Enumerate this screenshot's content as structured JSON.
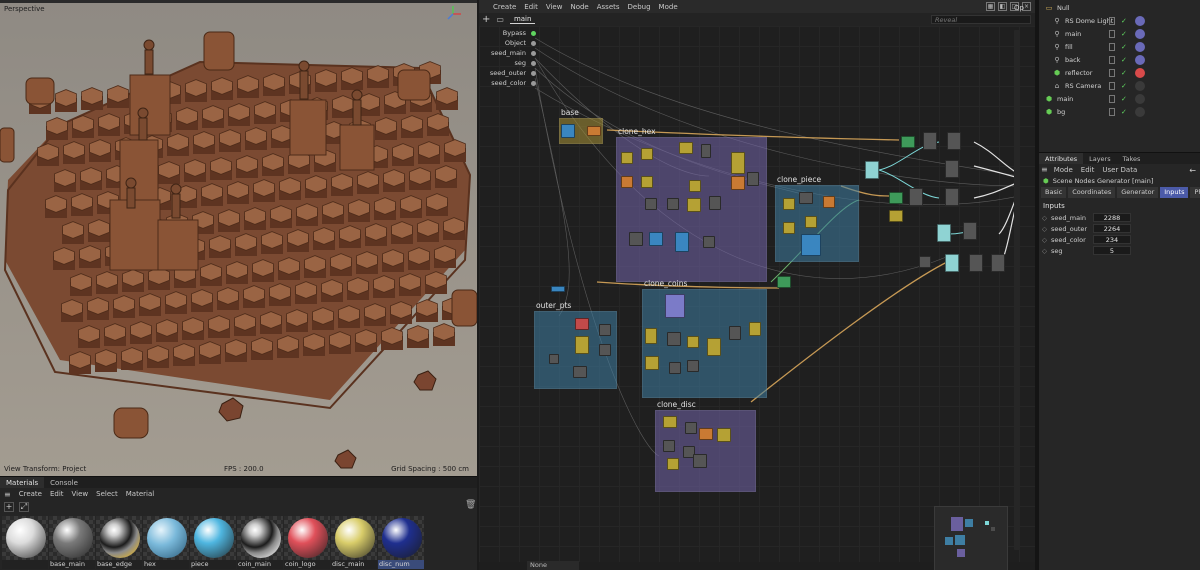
{
  "viewport": {
    "view_name": "Perspective",
    "view_transform": "View Transform: Project",
    "fps": "FPS : 200.0",
    "grid_spacing": "Grid Spacing : 500 cm"
  },
  "materials": {
    "tabs": [
      "Materials",
      "Console"
    ],
    "active_tab": "Materials",
    "menu": [
      "Create",
      "Edit",
      "View",
      "Select",
      "Material"
    ],
    "items": [
      {
        "name": "",
        "color": "#dcdcdc",
        "finish": "matte"
      },
      {
        "name": "base_main",
        "color": "#7a7a7a",
        "finish": "matte"
      },
      {
        "name": "base_edge",
        "color": "#c9a94a",
        "finish": "chrome"
      },
      {
        "name": "hex",
        "color": "#7ab9da",
        "finish": "glass"
      },
      {
        "name": "piece",
        "color": "#4fb6e0",
        "finish": "matte"
      },
      {
        "name": "coin_main",
        "color": "#cfcfcf",
        "finish": "chrome"
      },
      {
        "name": "coin_logo",
        "color": "#e0505a",
        "finish": "matte"
      },
      {
        "name": "disc_main",
        "color": "#d9cd6a",
        "finish": "matte"
      },
      {
        "name": "disc_num",
        "color": "#1f2f8f",
        "finish": "matte",
        "selected": true
      }
    ]
  },
  "node_editor": {
    "menu": [
      "Create",
      "Edit",
      "View",
      "Node",
      "Assets",
      "Debug",
      "Mode"
    ],
    "tab": "main",
    "search_placeholder": "Reveal",
    "inputs": [
      "Bypass",
      "Object",
      "seed_main",
      "seg",
      "seed_outer",
      "seed_color"
    ],
    "groups": [
      "base",
      "clone_hex",
      "clone_piece",
      "outer_pts",
      "clone_coins",
      "clone_disc"
    ],
    "output_label": "Op",
    "status": "None"
  },
  "objects": {
    "items": [
      {
        "name": "Null",
        "icon": "folder-icon"
      },
      {
        "name": "RS Dome Light",
        "icon": "light-icon"
      },
      {
        "name": "main",
        "icon": "light-icon"
      },
      {
        "name": "fill",
        "icon": "light-icon"
      },
      {
        "name": "back",
        "icon": "light-icon"
      },
      {
        "name": "reflector",
        "icon": "generator-icon"
      },
      {
        "name": "RS Camera",
        "icon": "camera-icon"
      },
      {
        "name": "main",
        "icon": "generator-icon"
      },
      {
        "name": "bg",
        "icon": "generator-icon"
      }
    ]
  },
  "attributes": {
    "tabs": [
      "Attributes",
      "Layers",
      "Takes"
    ],
    "active_tab": "Attributes",
    "menu": [
      "Mode",
      "Edit",
      "User Data"
    ],
    "title": "Scene Nodes Generator [main]",
    "subtabs": [
      "Basic",
      "Coordinates",
      "Generator",
      "Inputs",
      "Phong"
    ],
    "active_subtab": "Inputs",
    "group_title": "Inputs",
    "params": [
      {
        "name": "seed_main",
        "value": "2288"
      },
      {
        "name": "seed_outer",
        "value": "2264"
      },
      {
        "name": "seed_color",
        "value": "234"
      },
      {
        "name": "seg",
        "value": "5"
      }
    ]
  },
  "colors": {
    "accent": "#4b5aa8",
    "group_purple": "#6c63a8",
    "group_blue": "#3f7ea3",
    "node_yellow": "#b5a134",
    "node_orange": "#c97a33",
    "check_green": "#5fd35f"
  }
}
